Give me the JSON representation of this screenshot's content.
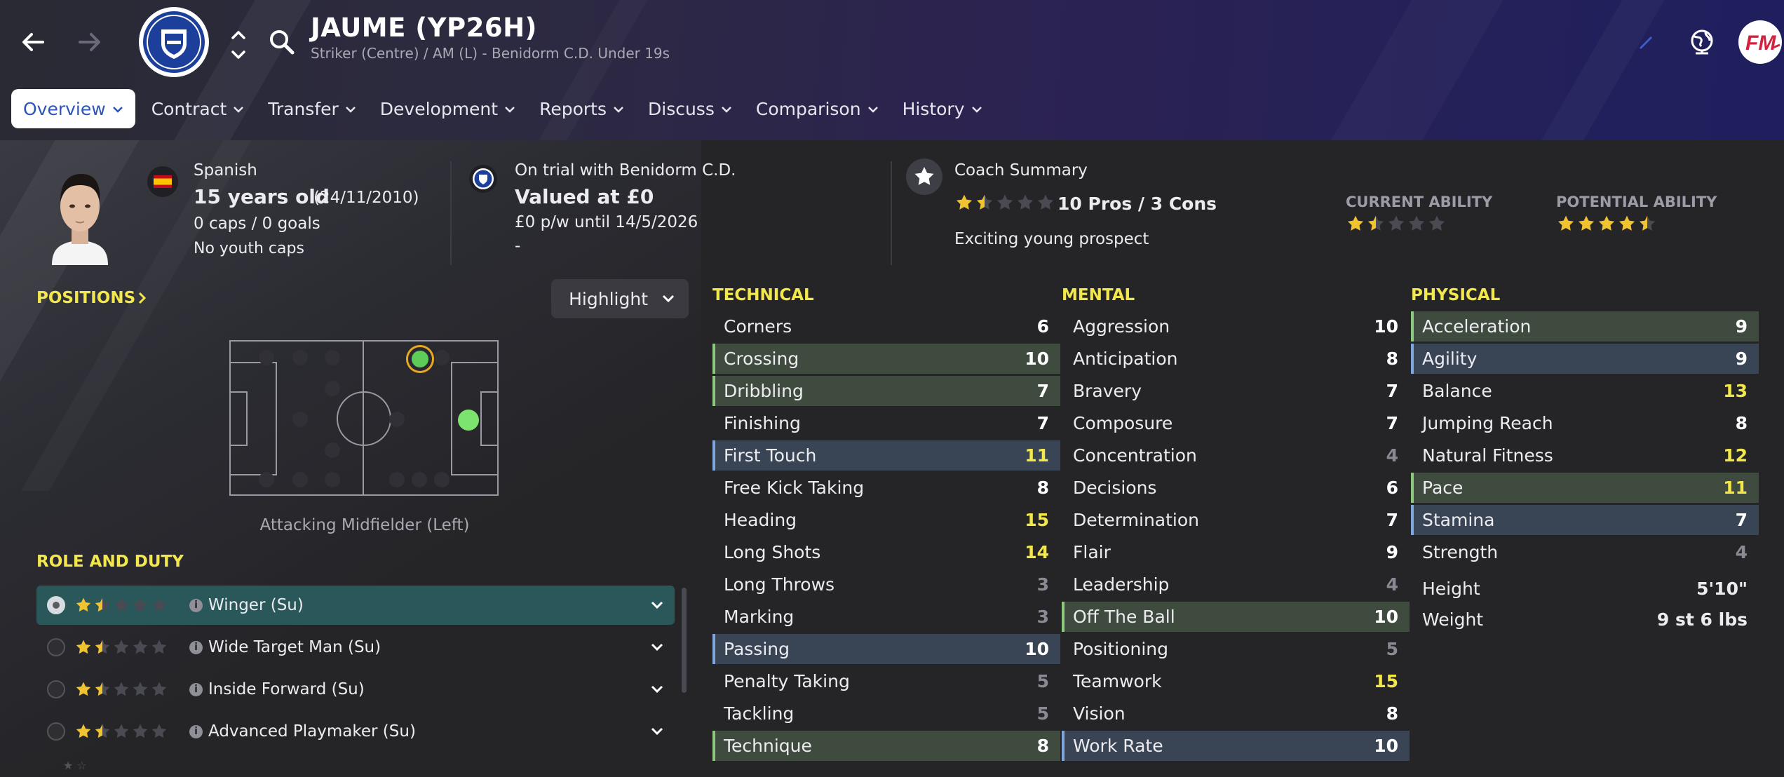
{
  "header": {
    "player_name": "JAUME (YP26H)",
    "subtitle": "Striker (Centre) / AM (L) - Benidorm C.D. Under 19s"
  },
  "tabs": [
    {
      "label": "Overview",
      "active": true
    },
    {
      "label": "Contract"
    },
    {
      "label": "Transfer"
    },
    {
      "label": "Development"
    },
    {
      "label": "Reports"
    },
    {
      "label": "Discuss"
    },
    {
      "label": "Comparison"
    },
    {
      "label": "History"
    }
  ],
  "bio": {
    "nationality": "Spanish",
    "age": "15 years old",
    "dob": "(24/11/2010)",
    "caps": "0 caps / 0 goals",
    "youth_caps": "No youth caps"
  },
  "club": {
    "status": "On trial with Benidorm C.D.",
    "value": "Valued at £0",
    "wage": "£0 p/w until 14/5/2026",
    "extra": "-"
  },
  "coach": {
    "title": "Coach Summary",
    "stars": 1.5,
    "pros_cons": "10 Pros / 3 Cons",
    "summary": "Exciting young prospect"
  },
  "ability": {
    "current_label": "CURRENT ABILITY",
    "current_stars": 1.5,
    "potential_label": "POTENTIAL ABILITY",
    "potential_stars": 4.5
  },
  "positions": {
    "title": "POSITIONS",
    "highlight": "Highlight",
    "caption": "Attacking Midfielder (Left)"
  },
  "roles": {
    "title": "ROLE AND DUTY",
    "items": [
      {
        "label": "Winger (Su)",
        "stars": 1.5,
        "selected": true
      },
      {
        "label": "Wide Target Man (Su)",
        "stars": 1.5
      },
      {
        "label": "Inside Forward (Su)",
        "stars": 1.5
      },
      {
        "label": "Advanced Playmaker (Su)",
        "stars": 1.5
      }
    ]
  },
  "attributes": {
    "technical": {
      "title": "TECHNICAL",
      "rows": [
        {
          "name": "Corners",
          "value": "6"
        },
        {
          "name": "Crossing",
          "value": "10",
          "hl": "green"
        },
        {
          "name": "Dribbling",
          "value": "7",
          "hl": "green"
        },
        {
          "name": "Finishing",
          "value": "7"
        },
        {
          "name": "First Touch",
          "value": "11",
          "hl": "blue"
        },
        {
          "name": "Free Kick Taking",
          "value": "8"
        },
        {
          "name": "Heading",
          "value": "15"
        },
        {
          "name": "Long Shots",
          "value": "14"
        },
        {
          "name": "Long Throws",
          "value": "3"
        },
        {
          "name": "Marking",
          "value": "3"
        },
        {
          "name": "Passing",
          "value": "10",
          "hl": "blue"
        },
        {
          "name": "Penalty Taking",
          "value": "5"
        },
        {
          "name": "Tackling",
          "value": "5"
        },
        {
          "name": "Technique",
          "value": "8",
          "hl": "green"
        }
      ]
    },
    "mental": {
      "title": "MENTAL",
      "rows": [
        {
          "name": "Aggression",
          "value": "10"
        },
        {
          "name": "Anticipation",
          "value": "8"
        },
        {
          "name": "Bravery",
          "value": "7"
        },
        {
          "name": "Composure",
          "value": "7"
        },
        {
          "name": "Concentration",
          "value": "4"
        },
        {
          "name": "Decisions",
          "value": "6"
        },
        {
          "name": "Determination",
          "value": "7"
        },
        {
          "name": "Flair",
          "value": "9"
        },
        {
          "name": "Leadership",
          "value": "4"
        },
        {
          "name": "Off The Ball",
          "value": "10",
          "hl": "green"
        },
        {
          "name": "Positioning",
          "value": "5"
        },
        {
          "name": "Teamwork",
          "value": "15"
        },
        {
          "name": "Vision",
          "value": "8"
        },
        {
          "name": "Work Rate",
          "value": "10",
          "hl": "blue"
        }
      ]
    },
    "physical": {
      "title": "PHYSICAL",
      "rows": [
        {
          "name": "Acceleration",
          "value": "9",
          "hl": "green"
        },
        {
          "name": "Agility",
          "value": "9",
          "hl": "blue"
        },
        {
          "name": "Balance",
          "value": "13"
        },
        {
          "name": "Jumping Reach",
          "value": "8"
        },
        {
          "name": "Natural Fitness",
          "value": "12"
        },
        {
          "name": "Pace",
          "value": "11",
          "hl": "green"
        },
        {
          "name": "Stamina",
          "value": "7",
          "hl": "blue"
        },
        {
          "name": "Strength",
          "value": "4"
        }
      ]
    },
    "height_label": "Height",
    "height": "5'10\"",
    "weight_label": "Weight",
    "weight": "9 st 6 lbs"
  },
  "colors": {
    "yellow_header": "#f3e84b",
    "highlight_green": "#3f4b3f",
    "highlight_blue": "#394455",
    "star_gold": "#f0c330",
    "accent_blue": "#2b55b8"
  }
}
